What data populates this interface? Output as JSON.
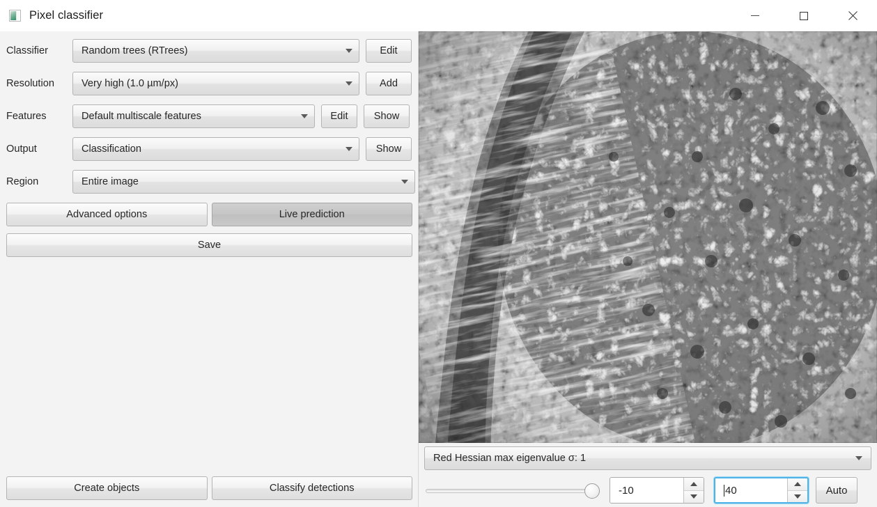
{
  "window": {
    "title": "Pixel classifier",
    "icon": "image-thumbnail-icon",
    "controls": {
      "minimize": "minimize-icon",
      "maximize": "maximize-icon",
      "close": "close-icon"
    }
  },
  "form": {
    "rows": [
      {
        "label": "Classifier",
        "value": "Random trees (RTrees)"
      },
      {
        "label": "Resolution",
        "value": "Very high (1.0 µm/px)"
      },
      {
        "label": "Features",
        "value": "Default multiscale features"
      },
      {
        "label": "Output",
        "value": "Classification"
      },
      {
        "label": "Region",
        "value": "Entire image"
      }
    ],
    "classifier_edit": "Edit",
    "resolution_add": "Add",
    "features_edit": "Edit",
    "features_show": "Show",
    "output_show": "Show"
  },
  "actions": {
    "advanced_options": "Advanced options",
    "live_prediction": "Live prediction",
    "live_prediction_active": true,
    "save": "Save",
    "create_objects": "Create objects",
    "classify_detections": "Classify detections"
  },
  "preview": {
    "feature_select": "Red Hessian max eigenvalue σ: 1",
    "slider_value_label": "",
    "min_value": "-10",
    "max_value": "40",
    "auto_label": "Auto"
  },
  "colors": {
    "panel_bg": "#f3f3f3",
    "titlebar_bg": "#ffffff",
    "focus_ring": "#4fb3e8",
    "text": "#262626",
    "border": "#b4b4b4"
  }
}
